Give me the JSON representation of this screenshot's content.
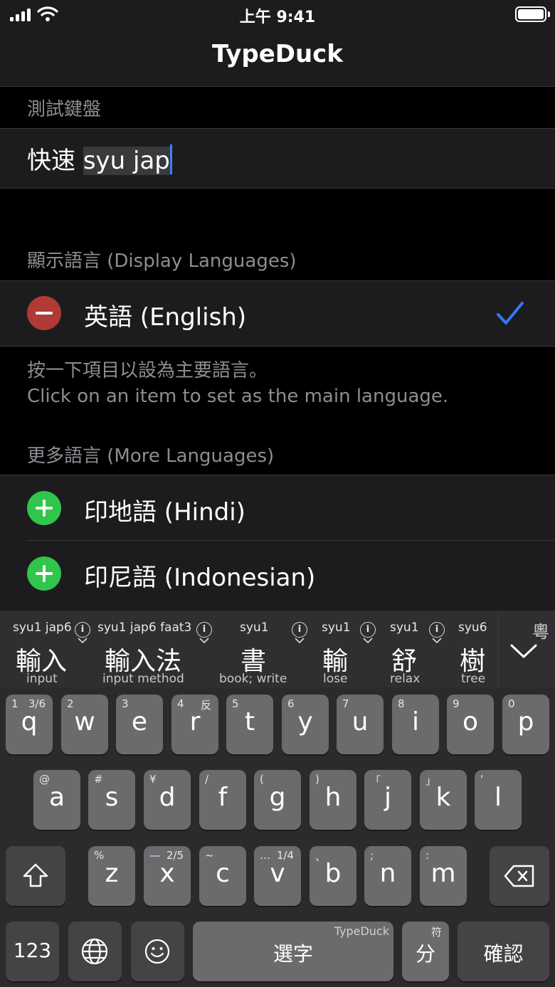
{
  "status_bar": {
    "time": "上午 9:41"
  },
  "nav": {
    "title": "TypeDuck"
  },
  "test_section": {
    "header": "測試鍵盤",
    "committed_text": "快速",
    "marked_text": "syu jap"
  },
  "display_languages": {
    "header": "顯示語言 (Display Languages)",
    "items": [
      {
        "label": "英語 (English)",
        "selected": true
      }
    ],
    "footer_zh": "按一下項目以設為主要語言。",
    "footer_en": "Click on an item to set as the main language."
  },
  "more_languages": {
    "header": "更多語言 (More Languages)",
    "items": [
      {
        "label": "印地語 (Hindi)"
      },
      {
        "label": "印尼語 (Indonesian)"
      }
    ]
  },
  "candidates": [
    {
      "jyutping": "syu1 jap6",
      "hanzi": "輸入",
      "gloss": "input"
    },
    {
      "jyutping": "syu1 jap6 faat3",
      "hanzi": "輸入法",
      "gloss": "input method"
    },
    {
      "jyutping": "syu1",
      "hanzi": "書",
      "gloss": "book; write"
    },
    {
      "jyutping": "syu1",
      "hanzi": "輸",
      "gloss": "lose"
    },
    {
      "jyutping": "syu1",
      "hanzi": "舒",
      "gloss": "relax"
    },
    {
      "jyutping": "syu6",
      "hanzi": "樹",
      "gloss": "tree"
    }
  ],
  "candidate_info_symbol": "i",
  "expand_language": "粵",
  "keys": {
    "row1": [
      {
        "main": "q",
        "sub": "1",
        "sub2": "3/6"
      },
      {
        "main": "w",
        "sub": "2",
        "sub2": ""
      },
      {
        "main": "e",
        "sub": "3",
        "sub2": ""
      },
      {
        "main": "r",
        "sub": "4",
        "sub2": "反"
      },
      {
        "main": "t",
        "sub": "5",
        "sub2": ""
      },
      {
        "main": "y",
        "sub": "6",
        "sub2": ""
      },
      {
        "main": "u",
        "sub": "7",
        "sub2": ""
      },
      {
        "main": "i",
        "sub": "8",
        "sub2": ""
      },
      {
        "main": "o",
        "sub": "9",
        "sub2": ""
      },
      {
        "main": "p",
        "sub": "0",
        "sub2": ""
      }
    ],
    "row2": [
      {
        "main": "a",
        "sub": "@",
        "sub2": ""
      },
      {
        "main": "s",
        "sub": "#",
        "sub2": ""
      },
      {
        "main": "d",
        "sub": "¥",
        "sub2": ""
      },
      {
        "main": "f",
        "sub": "/",
        "sub2": ""
      },
      {
        "main": "g",
        "sub": "(",
        "sub2": ""
      },
      {
        "main": "h",
        "sub": ")",
        "sub2": ""
      },
      {
        "main": "j",
        "sub": "「",
        "sub2": ""
      },
      {
        "main": "k",
        "sub": "」",
        "sub2": ""
      },
      {
        "main": "l",
        "sub": "'",
        "sub2": ""
      }
    ],
    "row3": [
      {
        "main": "z",
        "sub": "%",
        "sub2": ""
      },
      {
        "main": "x",
        "sub": "—",
        "sub2": "2/5"
      },
      {
        "main": "c",
        "sub": "~",
        "sub2": ""
      },
      {
        "main": "v",
        "sub": "…",
        "sub2": "1/4"
      },
      {
        "main": "b",
        "sub": "、",
        "sub2": ""
      },
      {
        "main": "n",
        "sub": ";",
        "sub2": ""
      },
      {
        "main": "m",
        "sub": ":",
        "sub2": ""
      }
    ],
    "numbers_label": "123",
    "space_label": "選字",
    "space_brand": "TypeDuck",
    "separator_label": "分",
    "separator_sub": "符",
    "return_label": "確認"
  }
}
